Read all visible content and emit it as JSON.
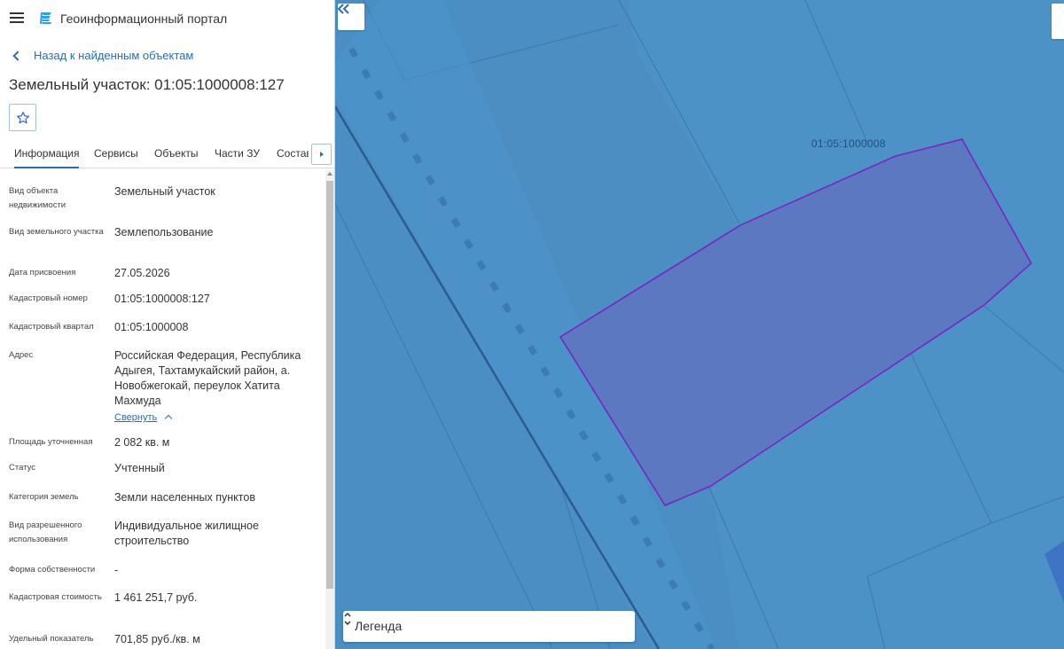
{
  "app": {
    "title": "Геоинформационный портал"
  },
  "navigation": {
    "back_label": "Назад к найденным объектам"
  },
  "object": {
    "title": "Земельный участок: 01:05:1000008:127"
  },
  "tabs": [
    {
      "label": "Информация",
      "active": true
    },
    {
      "label": "Сервисы",
      "active": false
    },
    {
      "label": "Объекты",
      "active": false
    },
    {
      "label": "Части ЗУ",
      "active": false
    },
    {
      "label": "Состав",
      "active": false
    }
  ],
  "info": {
    "object_type": {
      "label": "Вид объекта недвижимости",
      "value": "Земельный участок"
    },
    "parcel_type": {
      "label": "Вид земельного участка",
      "value": "Землепользование"
    },
    "assign_date": {
      "label": "Дата присвоения",
      "value": "27.05.2026"
    },
    "cadastral_number": {
      "label": "Кадастровый номер",
      "value": "01:05:1000008:127"
    },
    "cadastral_block": {
      "label": "Кадастровый квартал",
      "value": "01:05:1000008"
    },
    "address": {
      "label": "Адрес",
      "value": "Российская Федерация, Республика Адыгея, Тахтамукайский район, а. Новобжегокай, переулок Хатита Махмуда",
      "collapse_label": "Свернуть"
    },
    "area": {
      "label": "Площадь уточненная",
      "value": "2 082 кв. м"
    },
    "status": {
      "label": "Статус",
      "value": "Учтенный"
    },
    "land_category": {
      "label": "Категория земель",
      "value": "Земли населенных пунктов"
    },
    "permitted_use": {
      "label": "Вид разрешенного использования",
      "value": "Индивидуальное жилищное строительство"
    },
    "ownership": {
      "label": "Форма собственности",
      "value": "-"
    },
    "cadastral_value": {
      "label": "Кадастровая стоимость",
      "value": "1 461 251,7 руб."
    },
    "unit_indicator": {
      "label": "Удельный показатель",
      "value": "701,85 руб./кв. м"
    }
  },
  "map": {
    "block_label": "01:05:1000008",
    "legend_label": "Легенда",
    "colors": {
      "background": "#4d92c6",
      "parcel_fill": "#5b78c0",
      "parcel_stroke": "#7a1fc8",
      "road_fill": "#4a8fc8"
    }
  },
  "icons": {
    "menu": "hamburger-icon",
    "logo": "portal-logo-icon",
    "back": "chevron-left-icon",
    "favorite": "star-outline-icon",
    "tabs_next": "caret-right-icon",
    "collapse_panel": "double-chevron-left-icon",
    "legend_toggle": "chevron-up-down-icon"
  }
}
